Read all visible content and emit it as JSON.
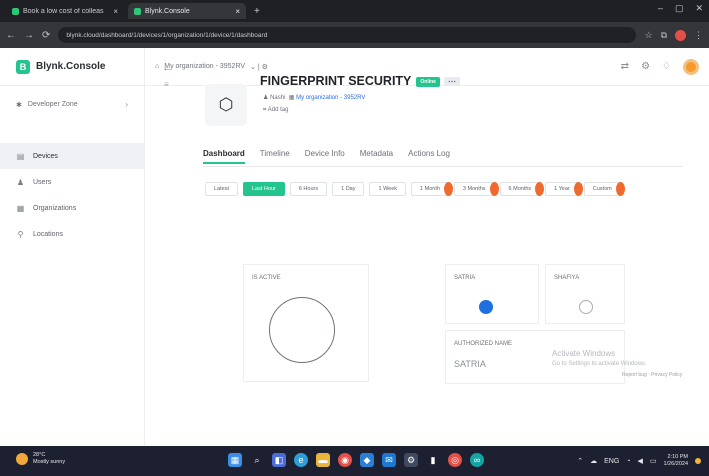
{
  "browser": {
    "tabs": [
      {
        "label": "Book a low cost of colleas"
      },
      {
        "label": "Blynk.Console"
      }
    ],
    "new_tab": "+",
    "window_controls": [
      "–",
      "▢",
      "✕"
    ],
    "address": "blynk.cloud/dashboard/1/devices/1/organization/1/device/1/dashboard",
    "nav_back": "←",
    "nav_forward": "→",
    "nav_reload": "⟳"
  },
  "sidebar": {
    "brand": "Blynk.Console",
    "workspace": "Developer Zone",
    "items": [
      {
        "label": "Devices",
        "icon": "devices-icon",
        "glyph": "▤",
        "active": true
      },
      {
        "label": "Users",
        "icon": "users-icon",
        "glyph": "♟",
        "active": false
      },
      {
        "label": "Organizations",
        "icon": "organizations-icon",
        "glyph": "▦",
        "active": false
      },
      {
        "label": "Locations",
        "icon": "location-icon",
        "glyph": "⚲",
        "active": false
      }
    ]
  },
  "topbar": {
    "breadcrumb": "My organization - 3952RV",
    "breadcrumb_sep": "⌄ | ⚙"
  },
  "device": {
    "name": "FINGERPRINT SECURITY",
    "status": "Online",
    "owner": "Nashi",
    "organization": "My organization - 3952RV",
    "add_tag": "Add tag"
  },
  "tabs": [
    "Dashboard",
    "Timeline",
    "Device Info",
    "Metadata",
    "Actions Log"
  ],
  "active_tab": "Dashboard",
  "ranges": [
    {
      "label": "Latest",
      "active": false,
      "pro": false
    },
    {
      "label": "Last Hour",
      "active": true,
      "pro": false
    },
    {
      "label": "6 Hours",
      "active": false,
      "pro": false
    },
    {
      "label": "1 Day",
      "active": false,
      "pro": false
    },
    {
      "label": "1 Week",
      "active": false,
      "pro": false
    },
    {
      "label": "1 Month",
      "active": false,
      "pro": true
    },
    {
      "label": "3 Months",
      "active": false,
      "pro": true
    },
    {
      "label": "6 Months",
      "active": false,
      "pro": true
    },
    {
      "label": "1 Year",
      "active": false,
      "pro": true
    },
    {
      "label": "Custom",
      "active": false,
      "pro": true
    }
  ],
  "widgets": {
    "is_active": {
      "label": "IS ACTIVE"
    },
    "led_1": {
      "label": "SATRIA",
      "state": "on"
    },
    "led_2": {
      "label": "SHAFIYA",
      "state": "off"
    },
    "authorized": {
      "label": "AUTHORIZED NAME",
      "value": "SATRIA"
    }
  },
  "watermark": {
    "line1": "Activate Windows",
    "line2": "Go to Settings to activate Windows."
  },
  "report": "Report bug · Privacy Policy",
  "taskbar": {
    "weather_temp": "28°C",
    "weather_desc": "Mostly sunny",
    "time": "2:10 PM",
    "date": "1/26/2024",
    "lang": "ENG"
  },
  "colors": {
    "accent": "#23c48e",
    "led_on": "#1f6fe0",
    "pro_badge": "#ef6a2e"
  }
}
